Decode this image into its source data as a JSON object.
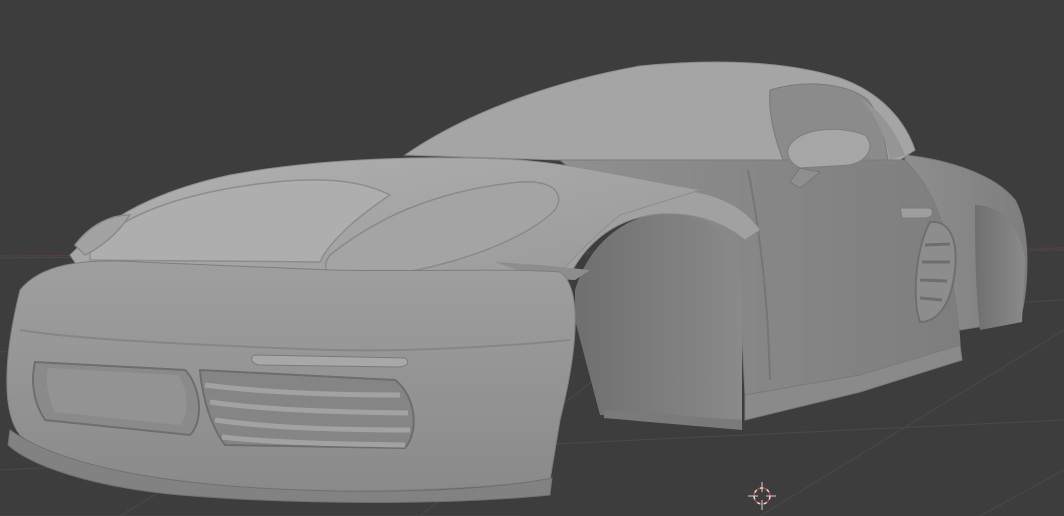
{
  "viewport": {
    "mode": "solid-shading",
    "background_color": "#3d3d3d",
    "grid_color": "#484848",
    "model_color": "#9a9a9a",
    "icons": {
      "origin": "3d-cursor-icon"
    }
  }
}
